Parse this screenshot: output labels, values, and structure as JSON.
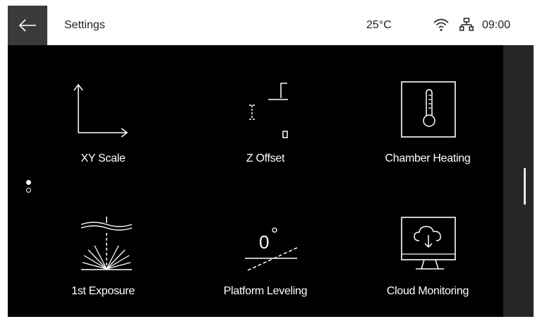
{
  "header": {
    "title": "Settings",
    "temperature": "25°C",
    "time": "09:00",
    "icons": [
      "back-arrow-icon",
      "wifi-icon",
      "network-icon"
    ]
  },
  "tiles": [
    {
      "label": "XY Scale",
      "icon": "xy-axis-icon"
    },
    {
      "label": "Z Offset",
      "icon": "z-offset-icon"
    },
    {
      "label": "Chamber Heating",
      "icon": "thermometer-icon"
    },
    {
      "label": "1st Exposure",
      "icon": "exposure-icon"
    },
    {
      "label": "Platform Leveling",
      "icon": "leveling-angle-icon"
    },
    {
      "label": "Cloud Monitoring",
      "icon": "cloud-monitor-icon"
    }
  ],
  "pager": {
    "pages": 2,
    "current": 1
  },
  "colors": {
    "background": "#000000",
    "topbar": "#ffffff",
    "back_button": "#3a3a3a",
    "text": "#ffffff"
  }
}
